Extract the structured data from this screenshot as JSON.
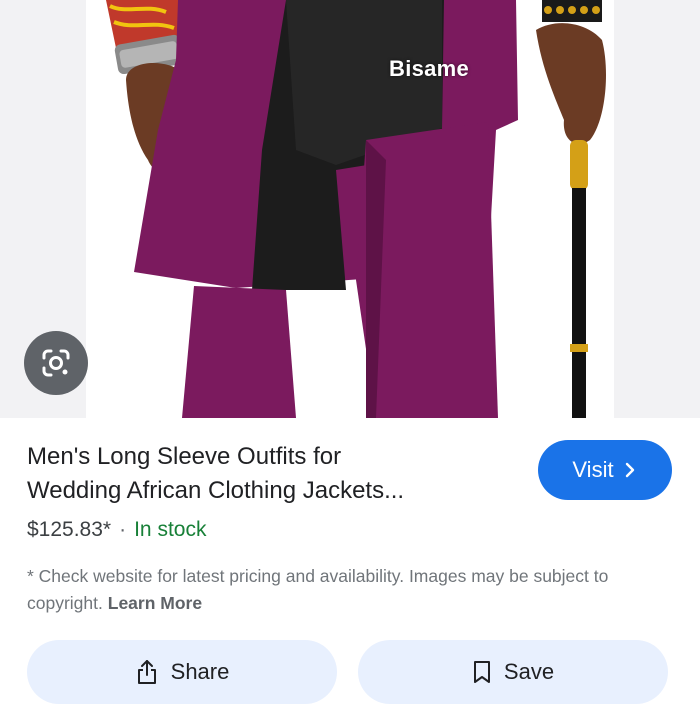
{
  "image": {
    "watermark": "Bisame"
  },
  "lens_button": {
    "icon": "google-lens-icon"
  },
  "product": {
    "title_line1": "Men's Long Sleeve Outfits for",
    "title_line2": "Wedding African Clothing Jackets...",
    "price": "$125.83*",
    "separator": "·",
    "stock": "In stock",
    "disclaimer": "* Check website for latest pricing and availability. Images may be subject to copyright.",
    "learn_more": "Learn More"
  },
  "actions": {
    "visit_label": "Visit",
    "visit_icon": "chevron-right-icon",
    "share_label": "Share",
    "share_icon": "share-icon",
    "save_label": "Save",
    "save_icon": "bookmark-icon"
  },
  "colors": {
    "accent_blue": "#1a73e8",
    "stock_green": "#188038",
    "pill_bg": "#e8f0fe",
    "outfit_purple": "#7b1a5e",
    "outfit_black": "#1c1c1c"
  }
}
